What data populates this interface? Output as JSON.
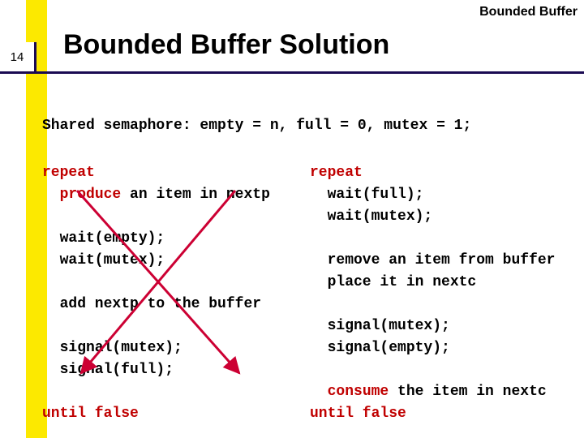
{
  "slide": {
    "page_number": "14",
    "topic_label": "Bounded Buffer",
    "title": "Bounded Buffer Solution",
    "shared_decl": "Shared semaphore: empty = n, full = 0, mutex = 1;"
  },
  "producer": {
    "repeat": "repeat",
    "produce": "produce",
    "produce_rest": " an item in nextp",
    "blank1": "",
    "wait_empty": "  wait(empty);",
    "wait_mutex": "  wait(mutex);",
    "blank2": "",
    "add": "  add nextp to the buffer",
    "blank3": "",
    "sig_mutex": "  signal(mutex);",
    "sig_full": "  signal(full);",
    "blank4": "",
    "until": "until false"
  },
  "consumer": {
    "repeat": "repeat",
    "wait_full": "  wait(full);",
    "wait_mutex": "  wait(mutex);",
    "blank1": "",
    "remove": "  remove an item from buffer",
    "place": "  place it in nextc",
    "blank2": "",
    "sig_mutex": "  signal(mutex);",
    "sig_empty": "  signal(empty);",
    "blank3": "",
    "consume": "consume",
    "consume_rest": " the item in nextc",
    "until": "until false"
  },
  "colors": {
    "accent_yellow": "#fce900",
    "rule_navy": "#1a0a52",
    "keyword_red": "#c00000",
    "arrow_red": "#cc0033"
  }
}
